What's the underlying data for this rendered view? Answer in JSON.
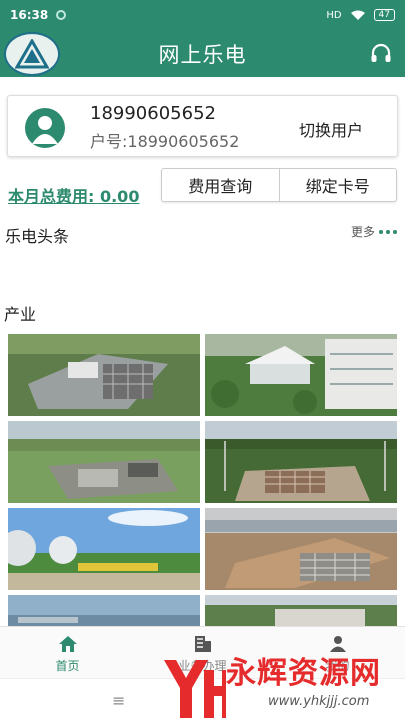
{
  "status_bar": {
    "time": "16:38",
    "network": "HD",
    "battery": "47"
  },
  "header": {
    "title": "网上乐电",
    "logo_icon": "company-logo",
    "service_icon": "headset-icon"
  },
  "user": {
    "phone": "18990605652",
    "account": "户号:18990605652",
    "switch_label": "切换用户"
  },
  "fee": {
    "label": "本月总费用: 0.00",
    "query_button": "费用查询",
    "bind_button": "绑定卡号"
  },
  "news": {
    "title": "乐电头条",
    "more": "更多"
  },
  "industry": {
    "title": "产业",
    "images": [
      "substation-aerial",
      "office-building",
      "rural-substation",
      "forest-substation",
      "gas-tanks",
      "river-substation",
      "city-river-1",
      "power-plant-2"
    ]
  },
  "tabs": [
    {
      "label": "首页",
      "icon": "home-icon",
      "active": true
    },
    {
      "label": "业务办理",
      "icon": "building-icon",
      "active": false
    },
    {
      "label": "我的",
      "icon": "person-icon",
      "active": false
    }
  ],
  "watermark": {
    "text": "永辉资源网",
    "url": "www.yhkjjj.com"
  },
  "colors": {
    "primary": "#2c8a6e",
    "watermark": "#e52b2b"
  }
}
